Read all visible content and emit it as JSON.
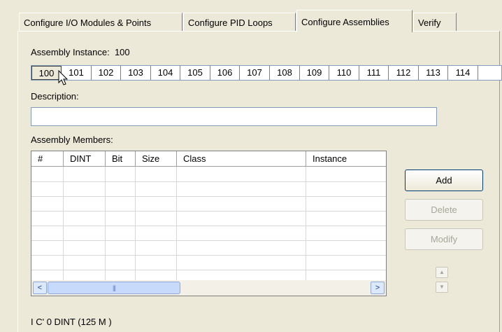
{
  "tabs": [
    {
      "label": "Configure I/O Modules & Points",
      "active": false
    },
    {
      "label": "Configure PID Loops",
      "active": false
    },
    {
      "label": "Configure Assemblies",
      "active": true
    },
    {
      "label": "Verify",
      "active": false
    }
  ],
  "assembly_instance": {
    "label": "Assembly Instance:",
    "value": "100"
  },
  "instances": [
    "100",
    "101",
    "102",
    "103",
    "104",
    "105",
    "106",
    "107",
    "108",
    "109",
    "110",
    "111",
    "112",
    "113",
    "114"
  ],
  "selected_instance": "100",
  "description": {
    "label": "Description:",
    "value": ""
  },
  "members": {
    "label": "Assembly Members:",
    "columns": [
      "#",
      "DINT",
      "Bit",
      "Size",
      "Class",
      "Instance"
    ],
    "rows": []
  },
  "buttons": {
    "add": "Add",
    "delete": "Delete",
    "modify": "Modify"
  },
  "scroll": {
    "left_arrow": "<",
    "right_arrow": ">",
    "thumb_grip": "|||",
    "up_arrow": "▲",
    "down_arrow": "▼"
  },
  "status_line": "I          C'      0 DINT    (125 M      )"
}
